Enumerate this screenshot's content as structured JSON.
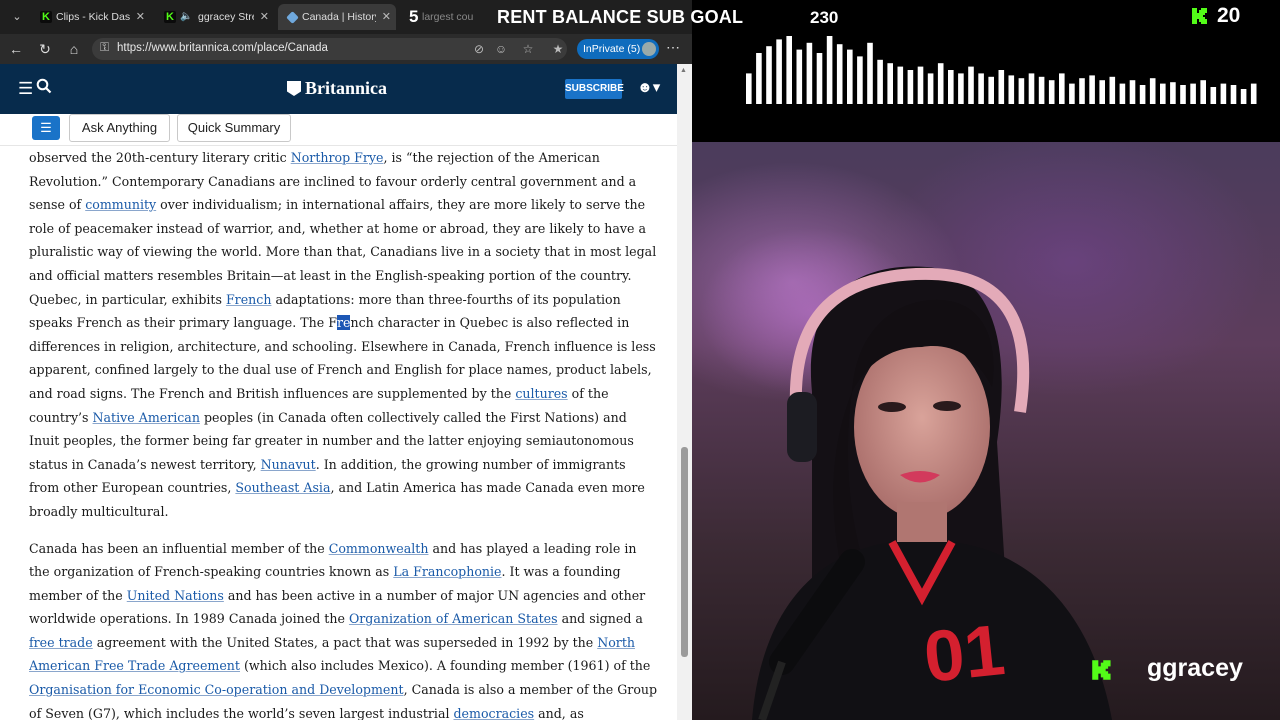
{
  "browser": {
    "tabs": [
      {
        "label": "Clips - Kick Dashboard",
        "active": false
      },
      {
        "label": "ggracey Stream",
        "active": false
      },
      {
        "label": "Canada | History, Geography",
        "active": true
      },
      {
        "label": "largest countries",
        "active": false
      }
    ],
    "url": "https://www.britannica.com/place/Canada",
    "inprivate_label": "InPrivate (5)"
  },
  "site": {
    "logo": "Britannica",
    "subscribe_label": "SUBSCRIBE",
    "ask_label": "Ask Anything",
    "summary_label": "Quick Summary"
  },
  "article": {
    "p1": {
      "s1": "observed the 20th-century literary critic ",
      "l1": "Northrop Frye",
      "s2": ", is “the rejection of the American Revolution.” Contemporary Canadians are inclined to favour orderly central government and a sense of ",
      "l2": "community",
      "s3": " over individualism; in international affairs, they are more likely to serve the role of peacemaker instead of warrior, and, whether at home or abroad, they are likely to have a pluralistic way of viewing the world. More than that, Canadians live in a society that in most legal and official matters resembles Britain—at least in the English-speaking portion of the country. Quebec, in particular, exhibits ",
      "l3": "French",
      "s4": " adaptations: more than three-fourths of its population speaks French as their primary language. The F",
      "hl": "re",
      "s5": "nch character in Quebec is also reflected in differences in religion, architecture, and schooling. Elsewhere in Canada, French influence is less apparent, confined largely to the dual use of French and English for place names, product labels, and road signs. The French and British influences are supplemented by the ",
      "l4": "cultures",
      "s6": " of the country’s ",
      "l5": "Native American",
      "s7": " peoples (in Canada often collectively called the First Nations) and Inuit peoples, the former being far greater in number and the latter enjoying semiautonomous status in Canada’s newest territory, ",
      "l6": "Nunavut",
      "s8": ". In addition, the growing number of immigrants from other European countries, ",
      "l7": "Southeast Asia",
      "s9": ", and Latin America has made Canada even more broadly multicultural."
    },
    "p2": {
      "s1": "Canada has been an influential member of the ",
      "l1": "Commonwealth",
      "s2": " and has played a leading role in the organization of French-speaking countries known as ",
      "l2": "La Francophonie",
      "s3": ". It was a founding member of the ",
      "l3": "United Nations",
      "s4": " and has been active in a number of major UN agencies and other worldwide operations. In 1989 Canada joined the ",
      "l4": "Organization of American States",
      "s5": " and signed a ",
      "l5": "free trade",
      "s6": " agreement with the United States, a pact that was superseded in 1992 by the ",
      "l6": "North American Free Trade Agreement",
      "s7": " (which also includes Mexico). A founding member (1961) of the ",
      "l7": "Organisation for Economic Co-operation and Development",
      "s8": ", Canada is also a member of the Group of Seven (G7), which includes the world’s seven largest industrial ",
      "l8": "democracies",
      "s9": " and, as"
    }
  },
  "overlay": {
    "goal_number": "5",
    "goal_label": "RENT BALANCE SUB GOAL",
    "goal_count": "230",
    "viewer_count": "20",
    "streamer_name": "ggracey",
    "bar_levels": [
      0.45,
      0.75,
      0.85,
      0.95,
      1.0,
      0.8,
      0.9,
      0.75,
      1.0,
      0.88,
      0.8,
      0.7,
      0.9,
      0.65,
      0.6,
      0.55,
      0.5,
      0.55,
      0.45,
      0.6,
      0.5,
      0.45,
      0.55,
      0.45,
      0.4,
      0.5,
      0.42,
      0.38,
      0.45,
      0.4,
      0.35,
      0.45,
      0.3,
      0.38,
      0.42,
      0.35,
      0.4,
      0.3,
      0.35,
      0.28,
      0.38,
      0.3,
      0.32,
      0.28,
      0.3,
      0.35,
      0.25,
      0.3,
      0.28,
      0.22,
      0.3
    ],
    "colors": {
      "kick_green": "#53fc18",
      "britannica_navy": "#072b4c",
      "link_blue": "#1a5aa8"
    }
  }
}
